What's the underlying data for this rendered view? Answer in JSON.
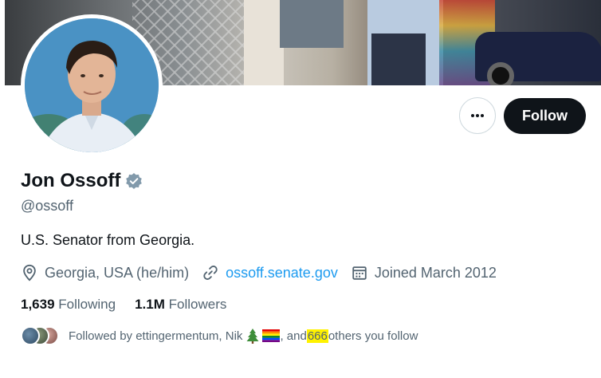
{
  "profile": {
    "display_name": "Jon Ossoff",
    "handle": "@ossoff",
    "bio": "U.S. Senator from Georgia.",
    "location": "Georgia, USA (he/him)",
    "website": "ossoff.senate.gov",
    "joined": "Joined March 2012"
  },
  "actions": {
    "follow_label": "Follow",
    "more_icon": "more-dots-icon"
  },
  "stats": {
    "following_count": "1,639",
    "following_label": "Following",
    "followers_count": "1.1M",
    "followers_label": "Followers"
  },
  "followed_by": {
    "prefix": "Followed by ettingermentum, Nik",
    "conjunction": ", and",
    "count": "666",
    "suffix": "others you follow",
    "emoji_icons": [
      "evergreen-tree-emoji",
      "rainbow-flag-emoji"
    ]
  },
  "colors": {
    "link": "#1d9bf0",
    "follow_button_bg": "#0f1419",
    "verified": "#829aab",
    "highlight": "#fff200",
    "secondary_text": "#536471"
  },
  "icons": {
    "verified": "verified-badge-icon",
    "location": "location-pin-icon",
    "link": "link-icon",
    "calendar": "calendar-icon"
  }
}
